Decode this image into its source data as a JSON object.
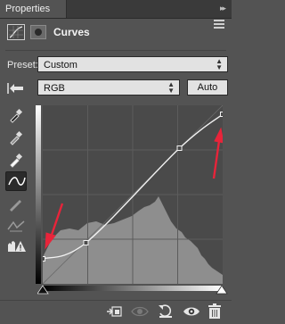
{
  "panel": {
    "tab_label": "Properties",
    "collapse_glyph": "▸▸"
  },
  "adjustment": {
    "title": "Curves"
  },
  "preset": {
    "label": "Preset:",
    "value": "Custom"
  },
  "channel": {
    "value": "RGB"
  },
  "auto_button": {
    "label": "Auto"
  },
  "tools": [
    "on-image-adjust-icon",
    "black-point-eyedropper-icon",
    "gray-point-eyedropper-icon",
    "white-point-eyedropper-icon",
    "curve-point-tool-icon",
    "pencil-draw-icon",
    "smooth-curve-icon",
    "clipping-warning-icon"
  ],
  "curve": {
    "points": [
      [
        0,
        0.14
      ],
      [
        0.24,
        0.23
      ],
      [
        0.76,
        0.76
      ],
      [
        1,
        0.95
      ]
    ]
  },
  "colors": {
    "annotation_arrow": "#e8243a",
    "panel_bg": "#535353",
    "graph_bg": "#4a4a4a"
  }
}
